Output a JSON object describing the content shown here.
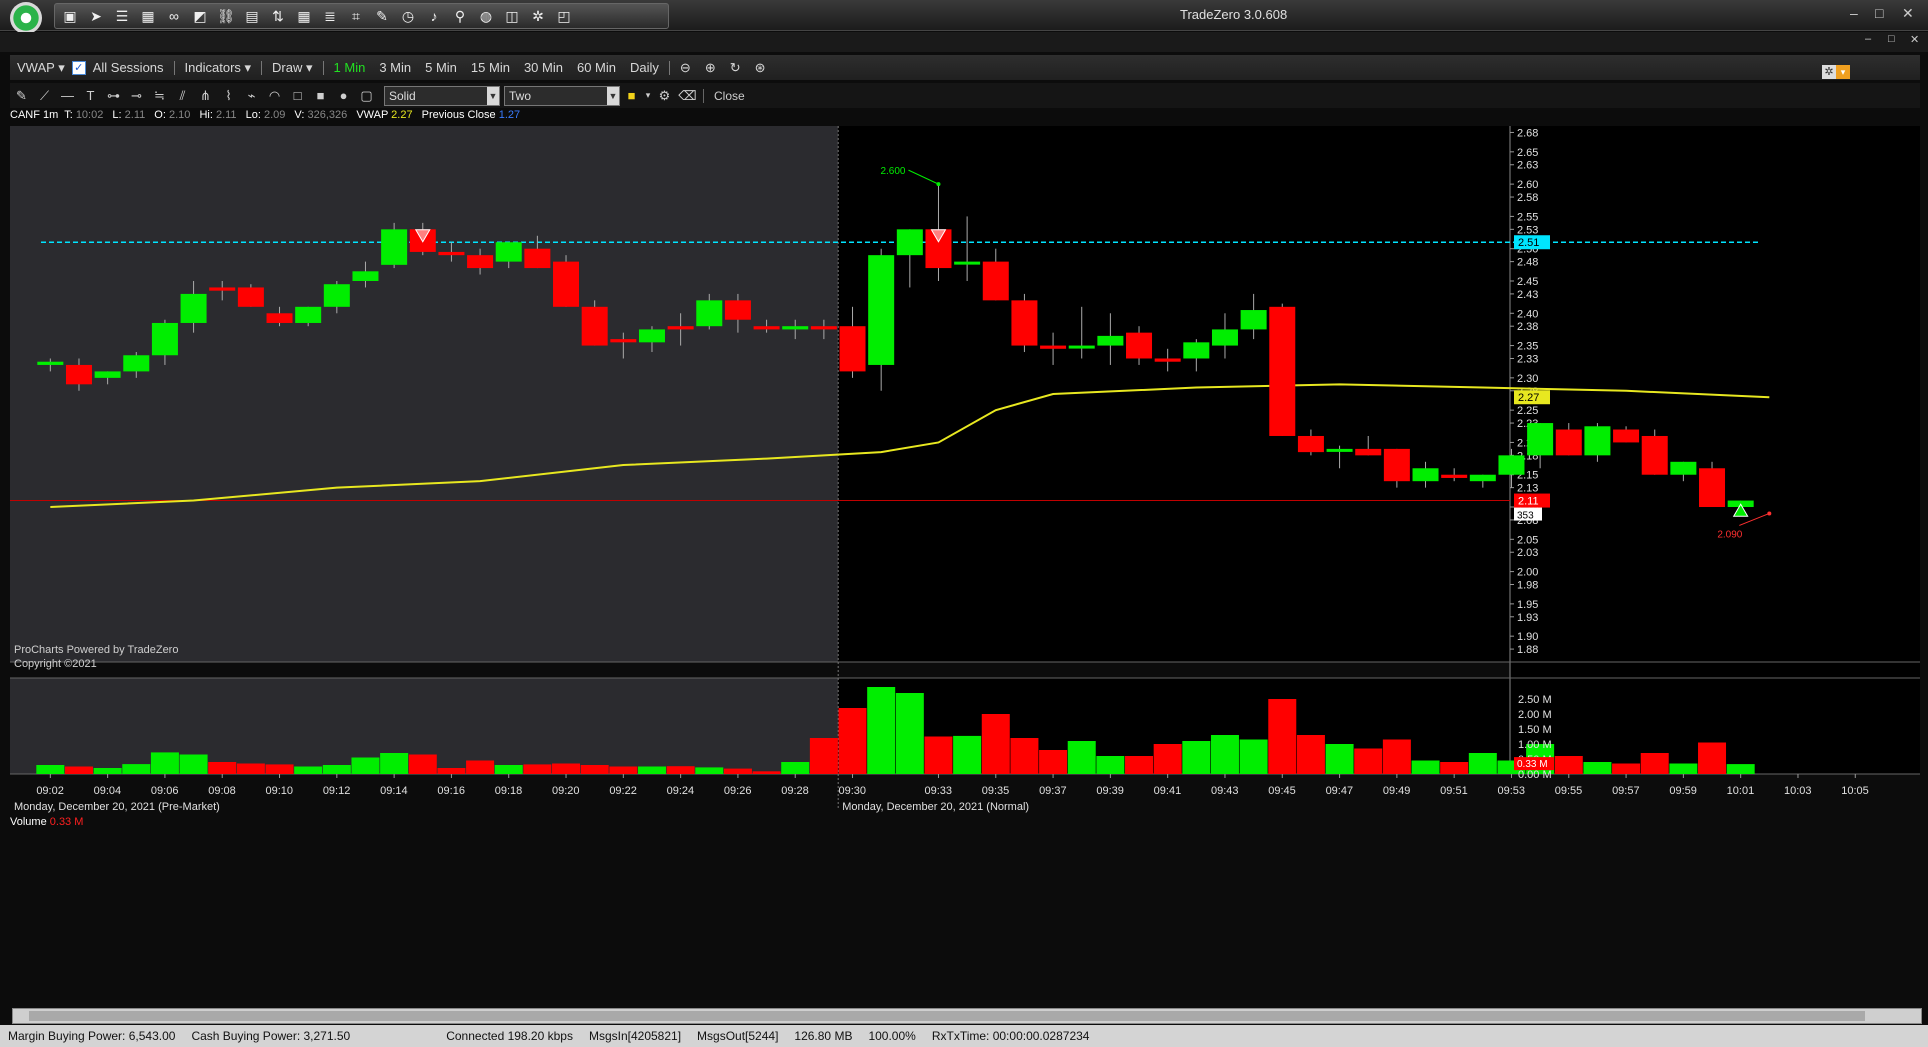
{
  "app": {
    "title": "TradeZero 3.0.608"
  },
  "window_controls": {
    "minimize": "–",
    "restore": "□",
    "close": "✕"
  },
  "toolbar": {
    "vwap": "VWAP",
    "all_sessions": "All Sessions",
    "indicators": "Indicators",
    "draw": "Draw",
    "timeframes": [
      "1 Min",
      "3 Min",
      "5 Min",
      "15 Min",
      "30 Min",
      "60 Min",
      "Daily"
    ],
    "active_timeframe": "1 Min"
  },
  "draw_toolbar": {
    "line_style": "Solid",
    "line_width": "Two",
    "close": "Close"
  },
  "info": {
    "symbol": "CANF 1m",
    "T": "10:02",
    "L": "2.11",
    "O": "2.10",
    "Hi": "2.11",
    "Lo": "2.09",
    "V": "326,326",
    "vwap_label": "VWAP",
    "vwap_value": "2.27",
    "prev_close_label": "Previous Close",
    "prev_close_value": "1.27"
  },
  "watermark": {
    "line1": "ProCharts Powered by TradeZero",
    "line2": "Copyright ©2021"
  },
  "volume_label": {
    "label": "Volume",
    "value": "0.33 M"
  },
  "session_labels": {
    "pre": "Monday, December 20, 2021 (Pre-Market)",
    "normal": "Monday, December 20, 2021 (Normal)"
  },
  "status": {
    "margin_bp": "Margin Buying Power: 6,543.00",
    "cash_bp": "Cash Buying Power: 3,271.50",
    "conn": "Connected 198.20 kbps",
    "msgs_in": "MsgsIn[4205821]",
    "msgs_out": "MsgsOut[5244]",
    "mem": "126.80 MB",
    "pct": "100.00%",
    "rxtx": "RxTxTime: 00:00:00.0287234"
  },
  "colors": {
    "up": "#00ee00",
    "down": "#ff0000",
    "vwap": "#e8e820",
    "hline": "#00e5ff",
    "bg_pre": "#2b2b2f",
    "bg_normal": "#000000"
  },
  "chart_data": {
    "type": "candlestick",
    "symbol": "CANF",
    "interval": "1m",
    "ylim": [
      1.86,
      2.69
    ],
    "y_ticks": [
      "2.68",
      "2.65",
      "2.63",
      "2.60",
      "2.58",
      "2.55",
      "2.53",
      "2.50",
      "2.48",
      "2.45",
      "2.43",
      "2.40",
      "2.38",
      "2.35",
      "2.33",
      "2.30",
      "2.28",
      "2.25",
      "2.23",
      "2.20",
      "2.18",
      "2.15",
      "2.13",
      "2.10",
      "2.08",
      "2.05",
      "2.03",
      "2.00",
      "1.98",
      "1.95",
      "1.93",
      "1.90",
      "1.88"
    ],
    "x_ticks": [
      "09:02",
      "09:04",
      "09:06",
      "09:08",
      "09:10",
      "09:12",
      "09:14",
      "09:16",
      "09:18",
      "09:20",
      "09:22",
      "09:24",
      "09:26",
      "09:28",
      "09:30",
      "09:33",
      "09:35",
      "09:37",
      "09:39",
      "09:41",
      "09:43",
      "09:45",
      "09:47",
      "09:49",
      "09:51",
      "09:53",
      "09:55",
      "09:57",
      "09:59",
      "10:01",
      "10:03",
      "10:05"
    ],
    "candles": [
      {
        "t": "09:02",
        "o": 2.32,
        "h": 2.33,
        "l": 2.31,
        "c": 2.325
      },
      {
        "t": "09:03",
        "o": 2.32,
        "h": 2.33,
        "l": 2.28,
        "c": 2.29
      },
      {
        "t": "09:04",
        "o": 2.3,
        "h": 2.31,
        "l": 2.29,
        "c": 2.31
      },
      {
        "t": "09:05",
        "o": 2.31,
        "h": 2.34,
        "l": 2.3,
        "c": 2.335
      },
      {
        "t": "09:06",
        "o": 2.335,
        "h": 2.39,
        "l": 2.32,
        "c": 2.385
      },
      {
        "t": "09:07",
        "o": 2.385,
        "h": 2.45,
        "l": 2.37,
        "c": 2.43
      },
      {
        "t": "09:08",
        "o": 2.44,
        "h": 2.45,
        "l": 2.42,
        "c": 2.435
      },
      {
        "t": "09:09",
        "o": 2.44,
        "h": 2.445,
        "l": 2.41,
        "c": 2.41
      },
      {
        "t": "09:10",
        "o": 2.4,
        "h": 2.41,
        "l": 2.38,
        "c": 2.385
      },
      {
        "t": "09:11",
        "o": 2.385,
        "h": 2.41,
        "l": 2.38,
        "c": 2.41
      },
      {
        "t": "09:12",
        "o": 2.41,
        "h": 2.45,
        "l": 2.4,
        "c": 2.445
      },
      {
        "t": "09:13",
        "o": 2.45,
        "h": 2.48,
        "l": 2.44,
        "c": 2.465
      },
      {
        "t": "09:14",
        "o": 2.475,
        "h": 2.54,
        "l": 2.47,
        "c": 2.53
      },
      {
        "t": "09:15",
        "o": 2.53,
        "h": 2.54,
        "l": 2.49,
        "c": 2.495
      },
      {
        "t": "09:16",
        "o": 2.495,
        "h": 2.51,
        "l": 2.48,
        "c": 2.49
      },
      {
        "t": "09:17",
        "o": 2.49,
        "h": 2.5,
        "l": 2.46,
        "c": 2.47
      },
      {
        "t": "09:18",
        "o": 2.48,
        "h": 2.51,
        "l": 2.47,
        "c": 2.51
      },
      {
        "t": "09:19",
        "o": 2.5,
        "h": 2.52,
        "l": 2.47,
        "c": 2.47
      },
      {
        "t": "09:20",
        "o": 2.48,
        "h": 2.49,
        "l": 2.41,
        "c": 2.41
      },
      {
        "t": "09:21",
        "o": 2.41,
        "h": 2.42,
        "l": 2.35,
        "c": 2.35
      },
      {
        "t": "09:22",
        "o": 2.36,
        "h": 2.37,
        "l": 2.33,
        "c": 2.355
      },
      {
        "t": "09:23",
        "o": 2.355,
        "h": 2.38,
        "l": 2.34,
        "c": 2.375
      },
      {
        "t": "09:24",
        "o": 2.38,
        "h": 2.4,
        "l": 2.35,
        "c": 2.375
      },
      {
        "t": "09:25",
        "o": 2.38,
        "h": 2.43,
        "l": 2.375,
        "c": 2.42
      },
      {
        "t": "09:26",
        "o": 2.42,
        "h": 2.43,
        "l": 2.37,
        "c": 2.39
      },
      {
        "t": "09:27",
        "o": 2.38,
        "h": 2.39,
        "l": 2.37,
        "c": 2.375
      },
      {
        "t": "09:28",
        "o": 2.375,
        "h": 2.39,
        "l": 2.36,
        "c": 2.38
      },
      {
        "t": "09:29",
        "o": 2.38,
        "h": 2.39,
        "l": 2.36,
        "c": 2.375
      },
      {
        "t": "09:30",
        "o": 2.38,
        "h": 2.41,
        "l": 2.3,
        "c": 2.31
      },
      {
        "t": "09:31",
        "o": 2.32,
        "h": 2.5,
        "l": 2.28,
        "c": 2.49
      },
      {
        "t": "09:32",
        "o": 2.49,
        "h": 2.53,
        "l": 2.44,
        "c": 2.53
      },
      {
        "t": "09:33",
        "o": 2.53,
        "h": 2.6,
        "l": 2.45,
        "c": 2.47
      },
      {
        "t": "09:34",
        "o": 2.48,
        "h": 2.55,
        "l": 2.45,
        "c": 2.48
      },
      {
        "t": "09:35",
        "o": 2.48,
        "h": 2.5,
        "l": 2.42,
        "c": 2.42
      },
      {
        "t": "09:36",
        "o": 2.42,
        "h": 2.43,
        "l": 2.34,
        "c": 2.35
      },
      {
        "t": "09:37",
        "o": 2.35,
        "h": 2.37,
        "l": 2.32,
        "c": 2.345
      },
      {
        "t": "09:38",
        "o": 2.35,
        "h": 2.41,
        "l": 2.33,
        "c": 2.35
      },
      {
        "t": "09:39",
        "o": 2.35,
        "h": 2.4,
        "l": 2.32,
        "c": 2.365
      },
      {
        "t": "09:40",
        "o": 2.37,
        "h": 2.38,
        "l": 2.32,
        "c": 2.33
      },
      {
        "t": "09:41",
        "o": 2.33,
        "h": 2.345,
        "l": 2.31,
        "c": 2.325
      },
      {
        "t": "09:42",
        "o": 2.33,
        "h": 2.36,
        "l": 2.31,
        "c": 2.355
      },
      {
        "t": "09:43",
        "o": 2.35,
        "h": 2.4,
        "l": 2.33,
        "c": 2.375
      },
      {
        "t": "09:44",
        "o": 2.375,
        "h": 2.43,
        "l": 2.36,
        "c": 2.405
      },
      {
        "t": "09:45",
        "o": 2.41,
        "h": 2.415,
        "l": 2.21,
        "c": 2.21
      },
      {
        "t": "09:46",
        "o": 2.21,
        "h": 2.22,
        "l": 2.18,
        "c": 2.185
      },
      {
        "t": "09:47",
        "o": 2.19,
        "h": 2.195,
        "l": 2.16,
        "c": 2.19
      },
      {
        "t": "09:48",
        "o": 2.19,
        "h": 2.21,
        "l": 2.18,
        "c": 2.18
      },
      {
        "t": "09:49",
        "o": 2.19,
        "h": 2.19,
        "l": 2.13,
        "c": 2.14
      },
      {
        "t": "09:50",
        "o": 2.14,
        "h": 2.17,
        "l": 2.13,
        "c": 2.16
      },
      {
        "t": "09:51",
        "o": 2.15,
        "h": 2.16,
        "l": 2.14,
        "c": 2.145
      },
      {
        "t": "09:52",
        "o": 2.14,
        "h": 2.15,
        "l": 2.13,
        "c": 2.15
      },
      {
        "t": "09:53",
        "o": 2.15,
        "h": 2.19,
        "l": 2.13,
        "c": 2.18
      },
      {
        "t": "09:54",
        "o": 2.18,
        "h": 2.23,
        "l": 2.16,
        "c": 2.23
      },
      {
        "t": "09:55",
        "o": 2.22,
        "h": 2.23,
        "l": 2.18,
        "c": 2.18
      },
      {
        "t": "09:56",
        "o": 2.18,
        "h": 2.23,
        "l": 2.17,
        "c": 2.225
      },
      {
        "t": "09:57",
        "o": 2.22,
        "h": 2.225,
        "l": 2.2,
        "c": 2.2
      },
      {
        "t": "09:58",
        "o": 2.21,
        "h": 2.22,
        "l": 2.15,
        "c": 2.15
      },
      {
        "t": "09:59",
        "o": 2.15,
        "h": 2.17,
        "l": 2.14,
        "c": 2.17
      },
      {
        "t": "10:00",
        "o": 2.16,
        "h": 2.17,
        "l": 2.1,
        "c": 2.1
      },
      {
        "t": "10:01",
        "o": 2.1,
        "h": 2.11,
        "l": 2.09,
        "c": 2.11
      }
    ],
    "volume": {
      "y_ticks": [
        "2.50 M",
        "2.00 M",
        "1.50 M",
        "1.00 M",
        "0.50 M",
        "0.00 M"
      ],
      "values": [
        0.3,
        0.25,
        0.2,
        0.33,
        0.72,
        0.65,
        0.4,
        0.35,
        0.32,
        0.25,
        0.3,
        0.55,
        0.7,
        0.65,
        0.2,
        0.45,
        0.3,
        0.32,
        0.35,
        0.3,
        0.25,
        0.25,
        0.26,
        0.22,
        0.18,
        0.09,
        0.4,
        1.2,
        2.2,
        2.9,
        2.7,
        1.25,
        1.27,
        2.0,
        1.2,
        0.8,
        1.1,
        0.6,
        0.6,
        1.0,
        1.1,
        1.3,
        1.15,
        2.5,
        1.3,
        1.0,
        0.85,
        1.15,
        0.45,
        0.4,
        0.7,
        0.45,
        1.0,
        0.6,
        0.4,
        0.35,
        0.7,
        0.35,
        1.05,
        0.33
      ]
    },
    "vwap_level": "2.27",
    "last_price": "2.11",
    "last_volume": "353",
    "high_marker": "2.600",
    "low_marker": "2.090",
    "hline_level": "2.51",
    "vol_value_label": "0.33 M",
    "vwap_line": [
      [
        0,
        2.1
      ],
      [
        5,
        2.11
      ],
      [
        10,
        2.13
      ],
      [
        15,
        2.14
      ],
      [
        20,
        2.165
      ],
      [
        25,
        2.175
      ],
      [
        29,
        2.185
      ],
      [
        31,
        2.2
      ],
      [
        33,
        2.25
      ],
      [
        35,
        2.275
      ],
      [
        40,
        2.285
      ],
      [
        45,
        2.29
      ],
      [
        50,
        2.285
      ],
      [
        55,
        2.28
      ],
      [
        60,
        2.27
      ]
    ]
  }
}
